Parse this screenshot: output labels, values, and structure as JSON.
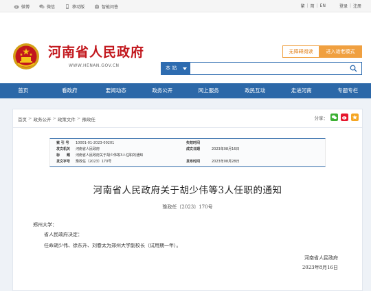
{
  "topbar": {
    "weibo": "微博",
    "wechat": "微信",
    "mobile": "移动版",
    "smart": "智能问答",
    "lang_trad": "繁",
    "lang_simp": "简",
    "lang_en": "EN",
    "login": "登录",
    "register": "注册"
  },
  "header": {
    "site_title": "河南省人民政府",
    "site_url": "WWW.HENAN.GOV.CN",
    "accessible_label": "无障碍阅读",
    "elder_label": "进入适老模式",
    "search_scope": "本 站",
    "search_placeholder": ""
  },
  "nav": [
    "首页",
    "看政府",
    "要闻动态",
    "政务公开",
    "网上服务",
    "政民互动",
    "走进河南",
    "专题专栏"
  ],
  "breadcrumb": [
    "首页",
    "政务公开",
    "政策文件",
    "豫政任"
  ],
  "share_label": "分享：",
  "meta": {
    "index_label": "索 引 号",
    "index_value": "10001-01-2023-00201",
    "validity_label": "失效时间",
    "validity_value": "",
    "issuer_label": "发文机关",
    "issuer_value": "河南省人民政府",
    "date_label": "成文日期",
    "date_value": "2023年08月16日",
    "title_label": "标　　题",
    "title_value": "河南省人民政府关于胡少伟等3人任职的通知",
    "docno_label": "发文字号",
    "docno_value": "豫政任〔2023〕170号",
    "pub_label": "发布时间",
    "pub_value": "2023年08月28日"
  },
  "article": {
    "title": "河南省人民政府关于胡少伟等3人任职的通知",
    "doc_no": "豫政任〔2023〕170号",
    "recipient": "郑州大学：",
    "line1": "省人民政府决定：",
    "line2": "任命胡少伟、徐东升、刘春太为郑州大学副校长（试用期一年）。",
    "signature": "河南省人民政府",
    "date": "2023年8月16日"
  },
  "colors": {
    "brand_red": "#c2171d",
    "nav_blue": "#2c68a8",
    "accent_orange": "#f0a040"
  }
}
